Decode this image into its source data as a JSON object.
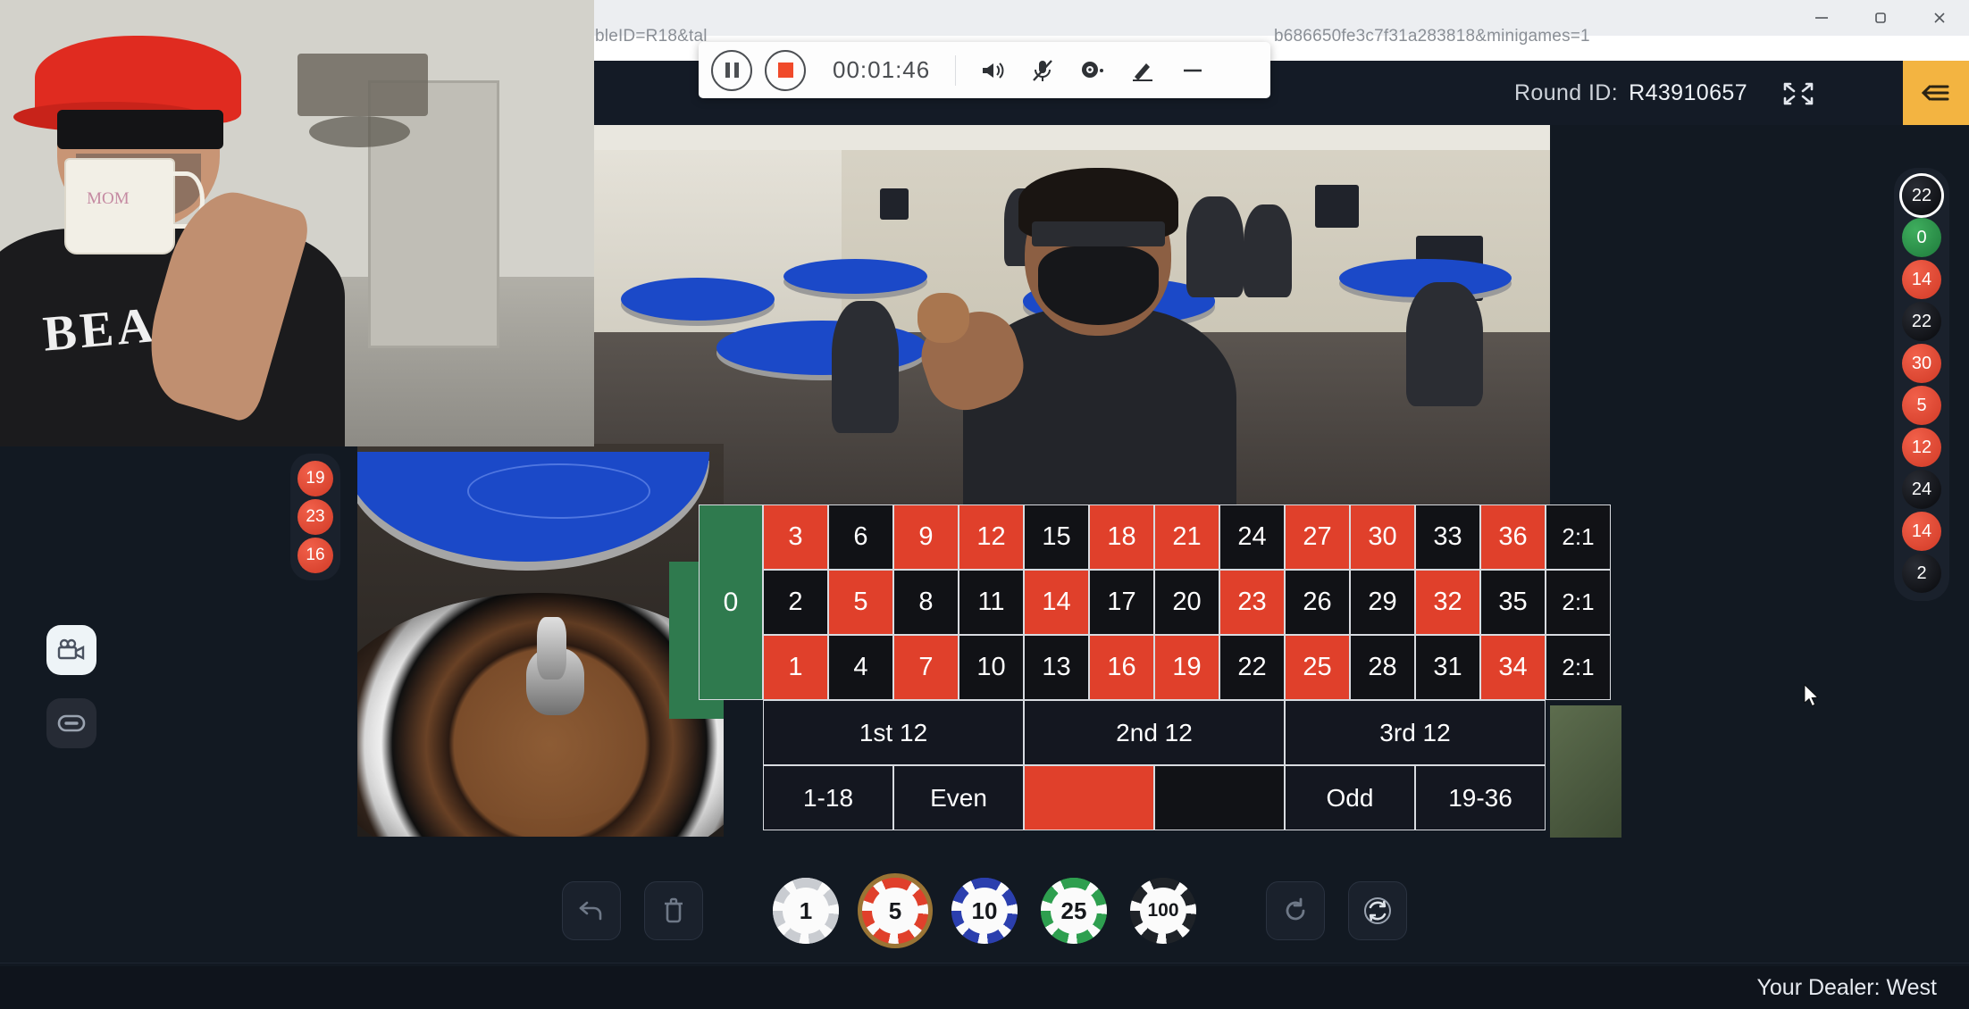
{
  "browser": {
    "url_left": "bleID=R18&tal",
    "url_right": "b686650fe3c7f31a283818&minigames=1",
    "window_controls": [
      {
        "name": "minimize",
        "glyph": "minimize-icon"
      },
      {
        "name": "maximize",
        "glyph": "maximize-icon"
      },
      {
        "name": "close",
        "glyph": "close-icon"
      }
    ]
  },
  "recorder": {
    "pause_label": "pause-icon",
    "stop_label": "stop-icon",
    "timer": "00:01:46",
    "tools": [
      {
        "name": "speaker-icon",
        "label": "Speaker"
      },
      {
        "name": "microphone-muted-icon",
        "label": "Microphone"
      },
      {
        "name": "webcam-icon",
        "label": "Webcam"
      },
      {
        "name": "pen-icon",
        "label": "Draw"
      },
      {
        "name": "minimize-icon",
        "label": "Minimize"
      }
    ]
  },
  "header": {
    "round_id_label": "Round ID:",
    "round_id_value": "R43910657",
    "fullscreen_icon": "fullscreen-icon",
    "menu_icon": "collapse-menu-icon",
    "menu_color": "#f3b441"
  },
  "history_right": [
    {
      "value": "22",
      "color": "black",
      "current": true
    },
    {
      "value": "0",
      "color": "green",
      "current": false
    },
    {
      "value": "14",
      "color": "red",
      "current": false
    },
    {
      "value": "22",
      "color": "black",
      "current": false
    },
    {
      "value": "30",
      "color": "red",
      "current": false
    },
    {
      "value": "5",
      "color": "red",
      "current": false
    },
    {
      "value": "12",
      "color": "red",
      "current": false
    },
    {
      "value": "24",
      "color": "black",
      "current": false
    },
    {
      "value": "14",
      "color": "red",
      "current": false
    },
    {
      "value": "2",
      "color": "black",
      "current": false
    }
  ],
  "history_left": [
    {
      "value": "19",
      "color": "red"
    },
    {
      "value": "23",
      "color": "red"
    },
    {
      "value": "16",
      "color": "red"
    }
  ],
  "rail": [
    {
      "name": "video-camera-icon",
      "state": "active"
    },
    {
      "name": "chip-oval-icon",
      "state": "inactive"
    }
  ],
  "bet_table": {
    "zero": "0",
    "rows": [
      [
        {
          "n": "3",
          "c": "red"
        },
        {
          "n": "6",
          "c": "black"
        },
        {
          "n": "9",
          "c": "red"
        },
        {
          "n": "12",
          "c": "red"
        },
        {
          "n": "15",
          "c": "black"
        },
        {
          "n": "18",
          "c": "red"
        },
        {
          "n": "21",
          "c": "red"
        },
        {
          "n": "24",
          "c": "black"
        },
        {
          "n": "27",
          "c": "red"
        },
        {
          "n": "30",
          "c": "red"
        },
        {
          "n": "33",
          "c": "black"
        },
        {
          "n": "36",
          "c": "red"
        },
        {
          "n": "2:1",
          "c": "ratio"
        }
      ],
      [
        {
          "n": "2",
          "c": "black"
        },
        {
          "n": "5",
          "c": "red"
        },
        {
          "n": "8",
          "c": "black"
        },
        {
          "n": "11",
          "c": "black"
        },
        {
          "n": "14",
          "c": "red"
        },
        {
          "n": "17",
          "c": "black"
        },
        {
          "n": "20",
          "c": "black"
        },
        {
          "n": "23",
          "c": "red"
        },
        {
          "n": "26",
          "c": "black"
        },
        {
          "n": "29",
          "c": "black"
        },
        {
          "n": "32",
          "c": "red"
        },
        {
          "n": "35",
          "c": "black"
        },
        {
          "n": "2:1",
          "c": "ratio"
        }
      ],
      [
        {
          "n": "1",
          "c": "red"
        },
        {
          "n": "4",
          "c": "black"
        },
        {
          "n": "7",
          "c": "red"
        },
        {
          "n": "10",
          "c": "black"
        },
        {
          "n": "13",
          "c": "black"
        },
        {
          "n": "16",
          "c": "red"
        },
        {
          "n": "19",
          "c": "red"
        },
        {
          "n": "22",
          "c": "black"
        },
        {
          "n": "25",
          "c": "red"
        },
        {
          "n": "28",
          "c": "black"
        },
        {
          "n": "31",
          "c": "black"
        },
        {
          "n": "34",
          "c": "red"
        },
        {
          "n": "2:1",
          "c": "ratio"
        }
      ]
    ],
    "dozens": [
      "1st 12",
      "2nd 12",
      "3rd 12"
    ],
    "outside": [
      {
        "label": "1-18",
        "style": "plain"
      },
      {
        "label": "Even",
        "style": "plain"
      },
      {
        "label": "",
        "style": "red"
      },
      {
        "label": "",
        "style": "black"
      },
      {
        "label": "Odd",
        "style": "plain"
      },
      {
        "label": "19-36",
        "style": "plain"
      }
    ]
  },
  "tray": {
    "undo_icon": "undo-icon",
    "clear_icon": "trash-icon",
    "repeat_icon": "repeat-icon",
    "double_icon": "double-repeat-icon",
    "chips": [
      {
        "value": "1",
        "rim": "#c9ccd1",
        "selected": false
      },
      {
        "value": "5",
        "rim": "#e0402b",
        "selected": true
      },
      {
        "value": "10",
        "rim": "#2b3fae",
        "selected": false
      },
      {
        "value": "25",
        "rim": "#2e9f4f",
        "selected": false
      },
      {
        "value": "100",
        "rim": "#1f2328",
        "selected": false
      }
    ]
  },
  "footer": {
    "dealer_text": "Your Dealer: West"
  }
}
